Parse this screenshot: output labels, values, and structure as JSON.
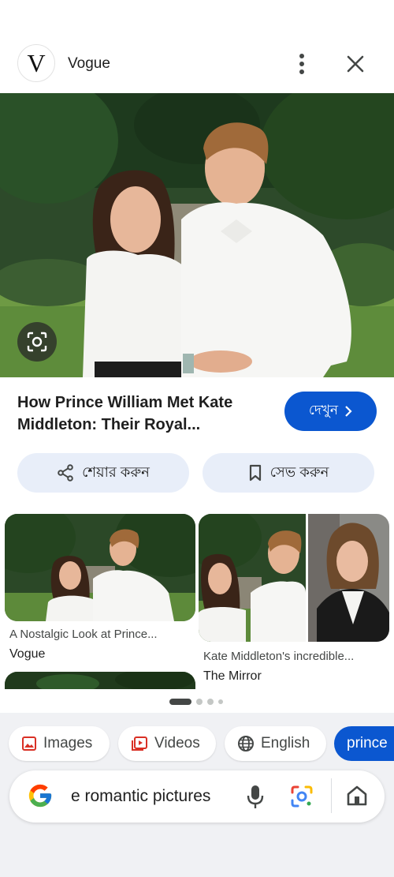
{
  "header": {
    "logo_letter": "V",
    "source_name": "Vogue"
  },
  "result": {
    "title": "How Prince William Met Kate Middleton: Their Royal...",
    "visit_label": "দেখুন",
    "share_label": "শেয়ার করুন",
    "save_label": "সেভ করুন"
  },
  "related": [
    {
      "title": "A Nostalgic Look at Prince...",
      "source": "Vogue"
    },
    {
      "title": "Kate Middleton's incredible...",
      "source": "The Mirror"
    }
  ],
  "pager": {
    "pages": 4,
    "active": 0
  },
  "chips": [
    {
      "label": "Images",
      "icon": "image-icon"
    },
    {
      "label": "Videos",
      "icon": "video-icon"
    },
    {
      "label": "English",
      "icon": "globe-icon"
    },
    {
      "label": "prince",
      "icon": ""
    }
  ],
  "search": {
    "query": "e romantic pictures"
  },
  "colors": {
    "accent": "#0b57d0",
    "action_bg": "#e8eef9",
    "bottom_bg": "#f0f1f4"
  }
}
